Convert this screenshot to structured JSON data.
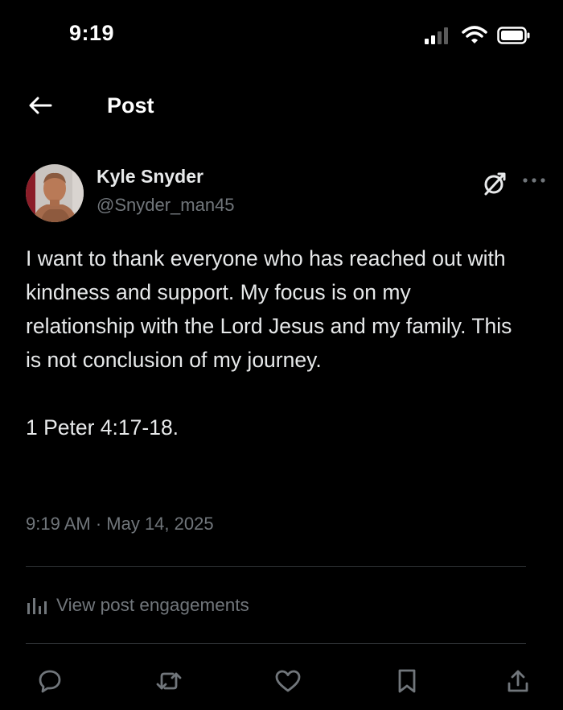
{
  "status_bar": {
    "time": "9:19",
    "icons": [
      "cellular-signal-icon",
      "wifi-icon",
      "battery-icon"
    ]
  },
  "nav": {
    "back_icon": "back-arrow-icon",
    "title": "Post"
  },
  "post": {
    "author": {
      "name": "Kyle Snyder",
      "handle": "@Snyder_man45",
      "avatar_icon": "avatar-photo"
    },
    "paragraphs": [
      "I want to thank everyone who has reached out with kindness and support. My focus is on my relationship with the Lord Jesus and my family. This is not conclusion of my journey.",
      "1 Peter 4:17-18."
    ],
    "timestamp": "9:19 AM · May 14, 2025"
  },
  "engagements": {
    "label": "View post engagements",
    "icon": "analytics-bars-icon"
  },
  "actions": [
    {
      "name": "reply-icon"
    },
    {
      "name": "repost-icon"
    },
    {
      "name": "like-icon"
    },
    {
      "name": "bookmark-icon"
    },
    {
      "name": "share-icon"
    }
  ],
  "colors": {
    "background": "#000000",
    "text_primary": "#e7e9ea",
    "text_secondary": "#71767b",
    "divider": "#2f3336"
  }
}
